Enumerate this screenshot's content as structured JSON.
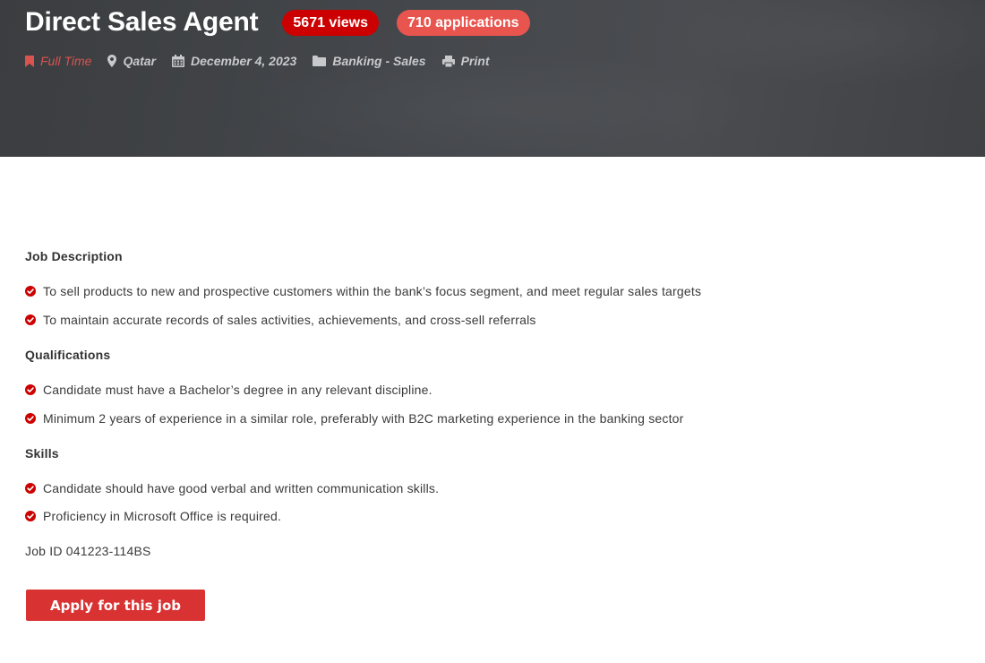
{
  "header": {
    "title": "Direct Sales Agent",
    "views_badge": "5671 views",
    "applications_badge": "710 applications",
    "meta": {
      "job_type": "Full Time",
      "location": "Qatar",
      "date": "December 4, 2023",
      "category": "Banking - Sales",
      "print_label": "Print"
    },
    "icons": {
      "job_type": "bookmark-icon",
      "location": "map-marker-icon",
      "date": "calendar-icon",
      "category": "folder-icon",
      "print": "printer-icon"
    }
  },
  "sections": {
    "description": {
      "heading": "Job Description",
      "items": [
        "To sell products to new and prospective customers within the bank’s focus segment, and meet regular sales targets",
        "To maintain accurate records of sales activities, achievements, and cross-sell referrals"
      ]
    },
    "qualifications": {
      "heading": "Qualifications",
      "items": [
        "Candidate must have a Bachelor’s degree in any relevant discipline.",
        "Minimum 2 years of experience in a similar role, preferably with B2C marketing experience in the banking sector"
      ]
    },
    "skills": {
      "heading": "Skills",
      "items": [
        "Candidate should have good verbal and written communication skills.",
        "Proficiency in Microsoft Office is required."
      ]
    }
  },
  "job_id": "Job ID 041223-114BS",
  "apply_button": "Apply for this job",
  "colors": {
    "hero_bg": "#45484c",
    "accent_red": "#cc0000",
    "badge_apps": "#e8554f",
    "button_red": "#d93232",
    "check_red": "#cc0000"
  }
}
